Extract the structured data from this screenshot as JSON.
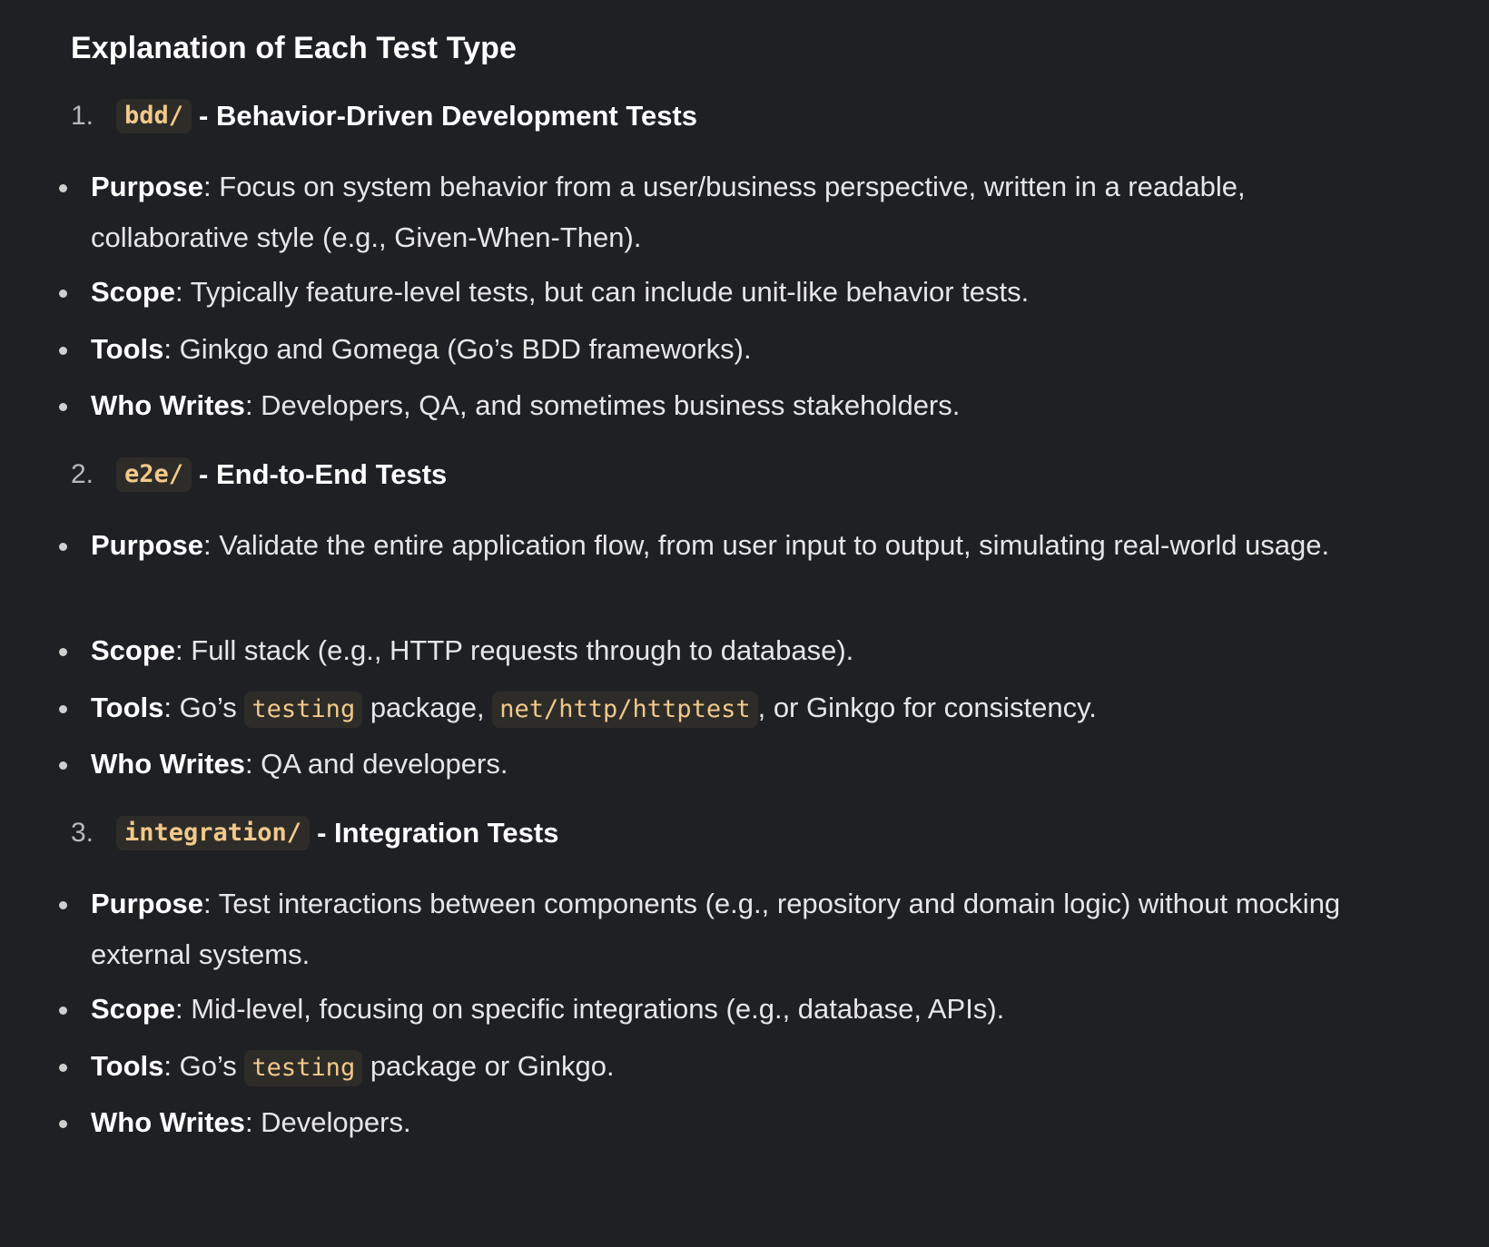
{
  "heading": "Explanation of Each Test Type",
  "sections": [
    {
      "number": "1.",
      "code": "bdd/",
      "title": "- Behavior-Driven Development Tests",
      "items": {
        "purpose": {
          "label": "Purpose",
          "text": ": Focus on system behavior from a user/business perspective, written in a readable, collaborative style (e.g., Given-When-Then)."
        },
        "scope": {
          "label": "Scope",
          "text": ": Typically feature-level tests, but can include unit-like behavior tests."
        },
        "tools": {
          "label": "Tools",
          "text": ": Ginkgo and Gomega (Go’s BDD frameworks)."
        },
        "who": {
          "label": "Who Writes",
          "text": ": Developers, QA, and sometimes business stakeholders."
        }
      }
    },
    {
      "number": "2.",
      "code": "e2e/",
      "title": "- End-to-End Tests",
      "items": {
        "purpose": {
          "label": "Purpose",
          "text": ": Validate the entire application flow, from user input to output, simulating real-world usage."
        },
        "scope": {
          "label": "Scope",
          "text": ": Full stack (e.g., HTTP requests through to database)."
        },
        "tools": {
          "label": "Tools",
          "pre": ": Go’s ",
          "code1": "testing",
          "mid": " package, ",
          "code2": "net/http/httptest",
          "post": ", or Ginkgo for consistency."
        },
        "who": {
          "label": "Who Writes",
          "text": ": QA and developers."
        }
      }
    },
    {
      "number": "3.",
      "code": "integration/",
      "title": "- Integration Tests",
      "items": {
        "purpose": {
          "label": "Purpose",
          "text": ": Test interactions between components (e.g., repository and domain logic) without mocking external systems."
        },
        "scope": {
          "label": "Scope",
          "text": ": Mid-level, focusing on specific integrations (e.g., database, APIs)."
        },
        "tools": {
          "label": "Tools",
          "pre": ": Go’s ",
          "code1": "testing",
          "post": " package or Ginkgo."
        },
        "who": {
          "label": "Who Writes",
          "text": ": Developers."
        }
      }
    }
  ]
}
